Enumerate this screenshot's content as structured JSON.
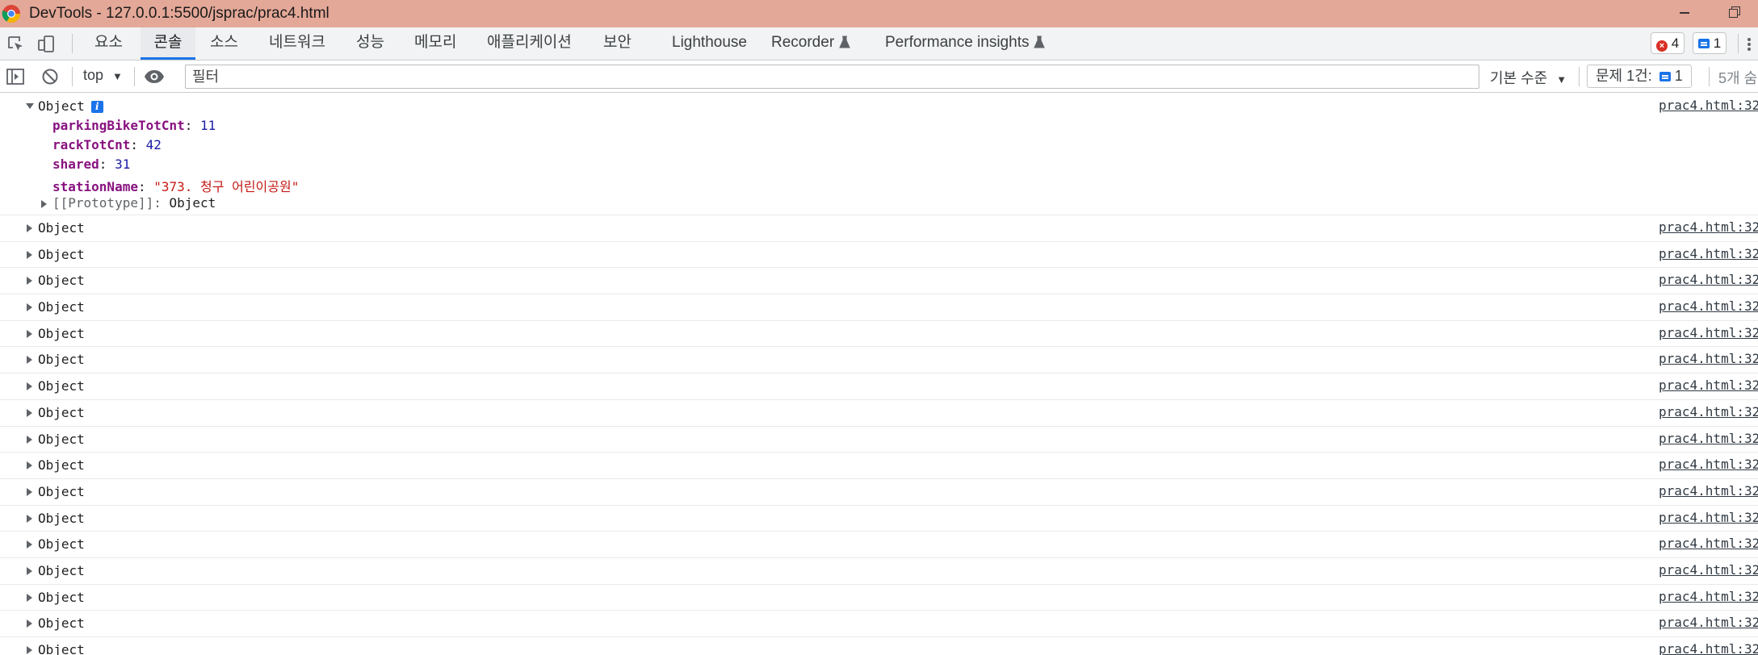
{
  "window": {
    "title": "DevTools - 127.0.0.1:5500/jsprac/prac4.html"
  },
  "tabs": [
    {
      "label": "요소",
      "active": false
    },
    {
      "label": "콘솔",
      "active": true
    },
    {
      "label": "소스",
      "active": false
    },
    {
      "label": "네트워크",
      "active": false
    },
    {
      "label": "성능",
      "active": false
    },
    {
      "label": "메모리",
      "active": false
    },
    {
      "label": "애플리케이션",
      "active": false
    },
    {
      "label": "보안",
      "active": false
    },
    {
      "label": "Lighthouse",
      "active": false
    },
    {
      "label": "Recorder",
      "active": false,
      "icon": "flask-icon"
    },
    {
      "label": "Performance insights",
      "active": false,
      "icon": "flask-icon"
    }
  ],
  "badges": {
    "errors": "4",
    "messages": "1"
  },
  "console_toolbar": {
    "context": "top",
    "filter_placeholder": "필터",
    "levels": "기본 수준",
    "issues_label": "문제 1건:",
    "issues_count": "1",
    "hidden_count": "5개 숨"
  },
  "expanded_entry": {
    "label": "Object",
    "source": "prac4.html:32",
    "props": [
      {
        "key": "parkingBikeTotCnt",
        "value": "11",
        "kind": "num"
      },
      {
        "key": "rackTotCnt",
        "value": "42",
        "kind": "num"
      },
      {
        "key": "shared",
        "value": "31",
        "kind": "num"
      },
      {
        "key": "stationName",
        "value": "\"373. 청구 어린이공원\"",
        "kind": "str"
      }
    ],
    "prototype_key": "[[Prototype]]",
    "prototype_value": "Object"
  },
  "rows": [
    {
      "label": "Object",
      "source": "prac4.html:32"
    },
    {
      "label": "Object",
      "source": "prac4.html:32"
    },
    {
      "label": "Object",
      "source": "prac4.html:32"
    },
    {
      "label": "Object",
      "source": "prac4.html:32"
    },
    {
      "label": "Object",
      "source": "prac4.html:32"
    },
    {
      "label": "Object",
      "source": "prac4.html:32"
    },
    {
      "label": "Object",
      "source": "prac4.html:32"
    },
    {
      "label": "Object",
      "source": "prac4.html:32"
    },
    {
      "label": "Object",
      "source": "prac4.html:32"
    },
    {
      "label": "Object",
      "source": "prac4.html:32"
    },
    {
      "label": "Object",
      "source": "prac4.html:32"
    },
    {
      "label": "Object",
      "source": "prac4.html:32"
    },
    {
      "label": "Object",
      "source": "prac4.html:32"
    },
    {
      "label": "Object",
      "source": "prac4.html:32"
    },
    {
      "label": "Object",
      "source": "prac4.html:32"
    },
    {
      "label": "Object",
      "source": "prac4.html:32"
    },
    {
      "label": "Object",
      "source": "prac4.html:32"
    }
  ],
  "colors": {
    "titlebar": "#e4a898",
    "accent": "#1a73e8",
    "error": "#d93025",
    "prop_key": "#881280",
    "number": "#1a1aa6",
    "string": "#c41a16"
  }
}
